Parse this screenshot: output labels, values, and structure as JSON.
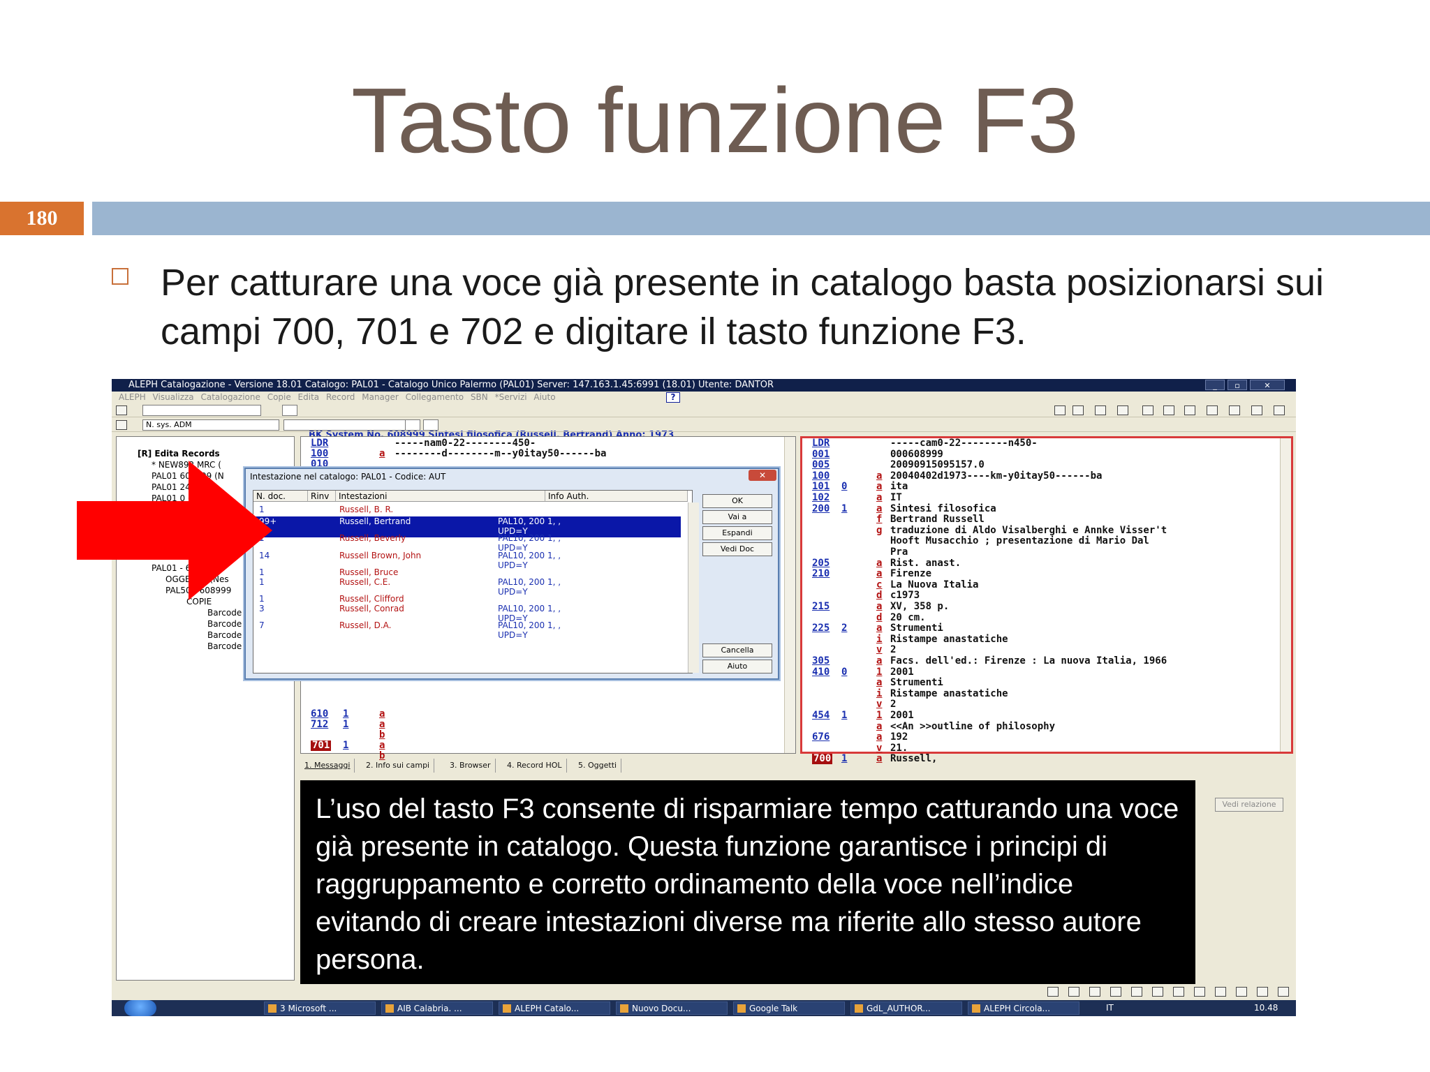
{
  "slide": {
    "title": "Tasto funzione F3",
    "number": "180",
    "bullet": "Per catturare una voce già presente in catalogo basta posizionarsi sui campi 700, 701 e 702 e digitare il tasto funzione F3."
  },
  "app": {
    "window_title": "ALEPH Catalogazione - Versione 18.01  Catalogo: PAL01 - Catalogo Unico Palermo (PAL01)  Server: 147.163.1.45:6991 (18.01)  Utente: DANTOR",
    "menu": "ALEPH   Visualizza   Catalogazione   Copie   Edita   Record Manager   Collegamento SBN   *Servizi   Aiuto",
    "help": "?",
    "record_title": "BK System No. 608999 Sintesi filosofica (Russell, Bertrand) Anno: 1973",
    "sys_select": "N. sys. ADM",
    "tree": [
      "[R] Edita Records",
      "* NEW892.MRC (",
      "PAL01 608999 (N",
      "PAL01     247 (N",
      "PAL01     0 (N",
      "PAL01 - 608999",
      "OGGETTO (Nes",
      "PAL50 - 608999",
      "COPIE",
      "Barcode",
      "Barcode",
      "Barcode",
      "Barcode"
    ],
    "center_rows": [
      {
        "tag": "LDR",
        "ind": "",
        "sf": "",
        "val": "-----nam0-22--------450-"
      },
      {
        "tag": "100",
        "ind": "",
        "sf": "a",
        "val": "--------d--------m--y0itay50------ba"
      },
      {
        "tag": "010",
        "ind": "",
        "sf": "",
        "val": ""
      },
      {
        "tag": "610",
        "ind": "1",
        "sf": "a",
        "val": ""
      },
      {
        "tag": "712",
        "ind": "1",
        "sf": "a",
        "val": ""
      },
      {
        "tag": "",
        "ind": "",
        "sf": "b",
        "val": ""
      },
      {
        "tag": "701",
        "ind": "1",
        "sf": "a",
        "val": ""
      },
      {
        "tag": "",
        "ind": "",
        "sf": "b",
        "val": ""
      }
    ],
    "right_rows": [
      {
        "tag": "LDR",
        "ind": "",
        "sf": "",
        "val": "-----cam0-22--------n450-"
      },
      {
        "tag": "001",
        "ind": "",
        "sf": "",
        "val": "000608999"
      },
      {
        "tag": "005",
        "ind": "",
        "sf": "",
        "val": "20090915095157.0"
      },
      {
        "tag": "100",
        "ind": "",
        "sf": "a",
        "val": "20040402d1973----km-y0itay50------ba"
      },
      {
        "tag": "101",
        "ind": "0",
        "sf": "a",
        "val": "ita"
      },
      {
        "tag": "102",
        "ind": "",
        "sf": "a",
        "val": "IT"
      },
      {
        "tag": "200",
        "ind": "1",
        "sf": "a",
        "val": "Sintesi filosofica"
      },
      {
        "tag": "",
        "ind": "",
        "sf": "f",
        "val": "Bertrand Russell"
      },
      {
        "tag": "",
        "ind": "",
        "sf": "g",
        "val": "traduzione di Aldo Visalberghi e Annke Visser't"
      },
      {
        "tag": "",
        "ind": "",
        "sf": "",
        "val": "Hooft Musacchio ; presentazione di Mario Dal"
      },
      {
        "tag": "",
        "ind": "",
        "sf": "",
        "val": "Pra"
      },
      {
        "tag": "205",
        "ind": "",
        "sf": "a",
        "val": "Rist. anast."
      },
      {
        "tag": "210",
        "ind": "",
        "sf": "a",
        "val": "Firenze"
      },
      {
        "tag": "",
        "ind": "",
        "sf": "c",
        "val": "La Nuova Italia"
      },
      {
        "tag": "",
        "ind": "",
        "sf": "d",
        "val": "c1973"
      },
      {
        "tag": "215",
        "ind": "",
        "sf": "a",
        "val": "XV, 358 p."
      },
      {
        "tag": "",
        "ind": "",
        "sf": "d",
        "val": "20 cm."
      },
      {
        "tag": "225",
        "ind": "2",
        "sf": "a",
        "val": "Strumenti"
      },
      {
        "tag": "",
        "ind": "",
        "sf": "i",
        "val": "Ristampe anastatiche"
      },
      {
        "tag": "",
        "ind": "",
        "sf": "v",
        "val": "2"
      },
      {
        "tag": "305",
        "ind": "",
        "sf": "a",
        "val": "Facs. dell'ed.: Firenze : La nuova Italia, 1966"
      },
      {
        "tag": "410",
        "ind": "0",
        "sf": "1",
        "val": "2001"
      },
      {
        "tag": "",
        "ind": "",
        "sf": "a",
        "val": "Strumenti"
      },
      {
        "tag": "",
        "ind": "",
        "sf": "i",
        "val": "Ristampe anastatiche"
      },
      {
        "tag": "",
        "ind": "",
        "sf": "v",
        "val": "2"
      },
      {
        "tag": "454",
        "ind": "1",
        "sf": "1",
        "val": "2001"
      },
      {
        "tag": "",
        "ind": "",
        "sf": "a",
        "val": "<<An >>outline of philosophy"
      },
      {
        "tag": "676",
        "ind": "",
        "sf": "a",
        "val": "192"
      },
      {
        "tag": "",
        "ind": "",
        "sf": "v",
        "val": "21."
      },
      {
        "tag": "700",
        "ind": "1",
        "sf": "a",
        "val": "Russell,"
      }
    ],
    "tabs": [
      "1. Messaggi",
      "2. Info sui campi",
      "3. Browser",
      "4. Record HOL",
      "5. Oggetti"
    ],
    "vedi_relazione": "Vedi relazione",
    "dialog": {
      "title": "Intestazione nel catalogo: PAL01 - Codice: AUT",
      "close": "✕",
      "columns": [
        "N. doc.",
        "Rinv",
        "Intestazioni",
        "Info Auth."
      ],
      "rows": [
        {
          "n": "1",
          "name": "Russell, B. R.",
          "info1": "",
          "info2": ""
        },
        {
          "n": "99+",
          "name": "Russell, Bertrand",
          "info1": "PAL10, 200 1, ,",
          "info2": "UPD=Y"
        },
        {
          "n": "1",
          "name": "Russell, Beverly",
          "info1": "PAL10, 200 1, ,",
          "info2": "UPD=Y"
        },
        {
          "n": "14",
          "name": "Russell Brown, John",
          "info1": "PAL10, 200 1, ,",
          "info2": "UPD=Y"
        },
        {
          "n": "1",
          "name": "Russell, Bruce",
          "info1": "",
          "info2": ""
        },
        {
          "n": "1",
          "name": "Russell, C.E.",
          "info1": "PAL10, 200 1, ,",
          "info2": "UPD=Y"
        },
        {
          "n": "1",
          "name": "Russell, Clifford",
          "info1": "",
          "info2": ""
        },
        {
          "n": "3",
          "name": "Russell, Conrad",
          "info1": "PAL10, 200 1, ,",
          "info2": "UPD=Y"
        },
        {
          "n": "7",
          "name": "Russell, D.A.",
          "info1": "PAL10, 200 1, ,",
          "info2": "UPD=Y"
        }
      ],
      "buttons": [
        "OK",
        "Vai a",
        "Espandi",
        "Vedi Doc",
        "Cancella",
        "Aiuto"
      ]
    },
    "caption": "L’uso del tasto F3 consente di risparmiare tempo catturando una voce già presente in catalogo. Questa funzione garantisce i principi di raggruppamento e corretto ordinamento della voce nell’indice evitando di creare intestazioni diverse ma riferite allo stesso autore persona.",
    "taskbar": [
      "3 Microsoft ...",
      "AIB Calabria. ...",
      "ALEPH Catalo...",
      "Nuovo Docu...",
      "Google Talk",
      "GdL_AUTHOR...",
      "ALEPH Circola..."
    ],
    "taskbar_lang": "IT",
    "clock": "10.48"
  },
  "colors": {
    "title": "#6e5c52",
    "slide_number_bg": "#d9732f",
    "band": "#9bb5d0",
    "arrow": "#ff0000",
    "selection": "#0a17a8"
  }
}
